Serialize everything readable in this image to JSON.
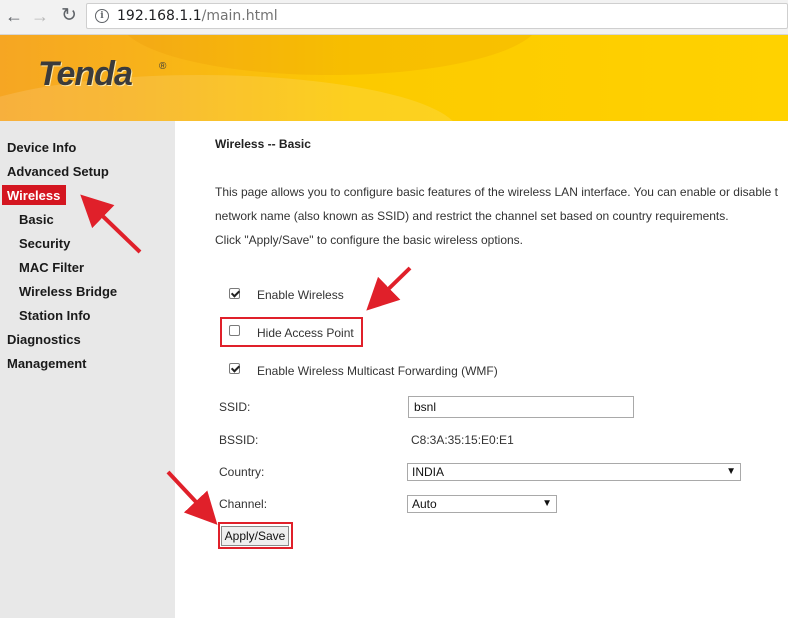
{
  "browser": {
    "url_host": "192.168.1.1",
    "url_path": "/main.html",
    "back_icon": "arrow-left",
    "forward_icon": "arrow-right",
    "reload_icon": "reload",
    "info_icon": "info-circle"
  },
  "header": {
    "logo_text": "Tenda",
    "logo_reg": "®"
  },
  "sidebar": {
    "items": [
      {
        "label": "Device Info",
        "level": "top"
      },
      {
        "label": "Advanced Setup",
        "level": "top"
      },
      {
        "label": "Wireless",
        "level": "top",
        "active": true
      },
      {
        "label": "Basic",
        "level": "sub"
      },
      {
        "label": "Security",
        "level": "sub"
      },
      {
        "label": "MAC Filter",
        "level": "sub"
      },
      {
        "label": "Wireless Bridge",
        "level": "sub"
      },
      {
        "label": "Station Info",
        "level": "sub"
      },
      {
        "label": "Diagnostics",
        "level": "top"
      },
      {
        "label": "Management",
        "level": "top"
      }
    ]
  },
  "main": {
    "title": "Wireless -- Basic",
    "description": [
      "This page allows you to configure basic features of the wireless LAN interface. You can enable or disable t",
      "network name (also known as SSID) and restrict the channel set based on country requirements.",
      "Click \"Apply/Save\" to configure the basic wireless options."
    ],
    "options": [
      {
        "label": "Enable Wireless",
        "checked": true
      },
      {
        "label": "Hide Access Point",
        "checked": false
      },
      {
        "label": "Enable Wireless Multicast Forwarding (WMF)",
        "checked": true
      }
    ],
    "fields": {
      "ssid_label": "SSID:",
      "ssid_value": "bsnl",
      "bssid_label": "BSSID:",
      "bssid_value": "C8:3A:35:15:E0:E1",
      "country_label": "Country:",
      "country_value": "INDIA",
      "channel_label": "Channel:",
      "channel_value": "Auto"
    },
    "apply_button": "Apply/Save"
  },
  "colors": {
    "header_orange": "#f6a623",
    "header_yellow": "#ffd200",
    "sidebar_bg": "#e8e8e8",
    "active_red": "#d41620",
    "annotation_red": "#e0202a"
  }
}
